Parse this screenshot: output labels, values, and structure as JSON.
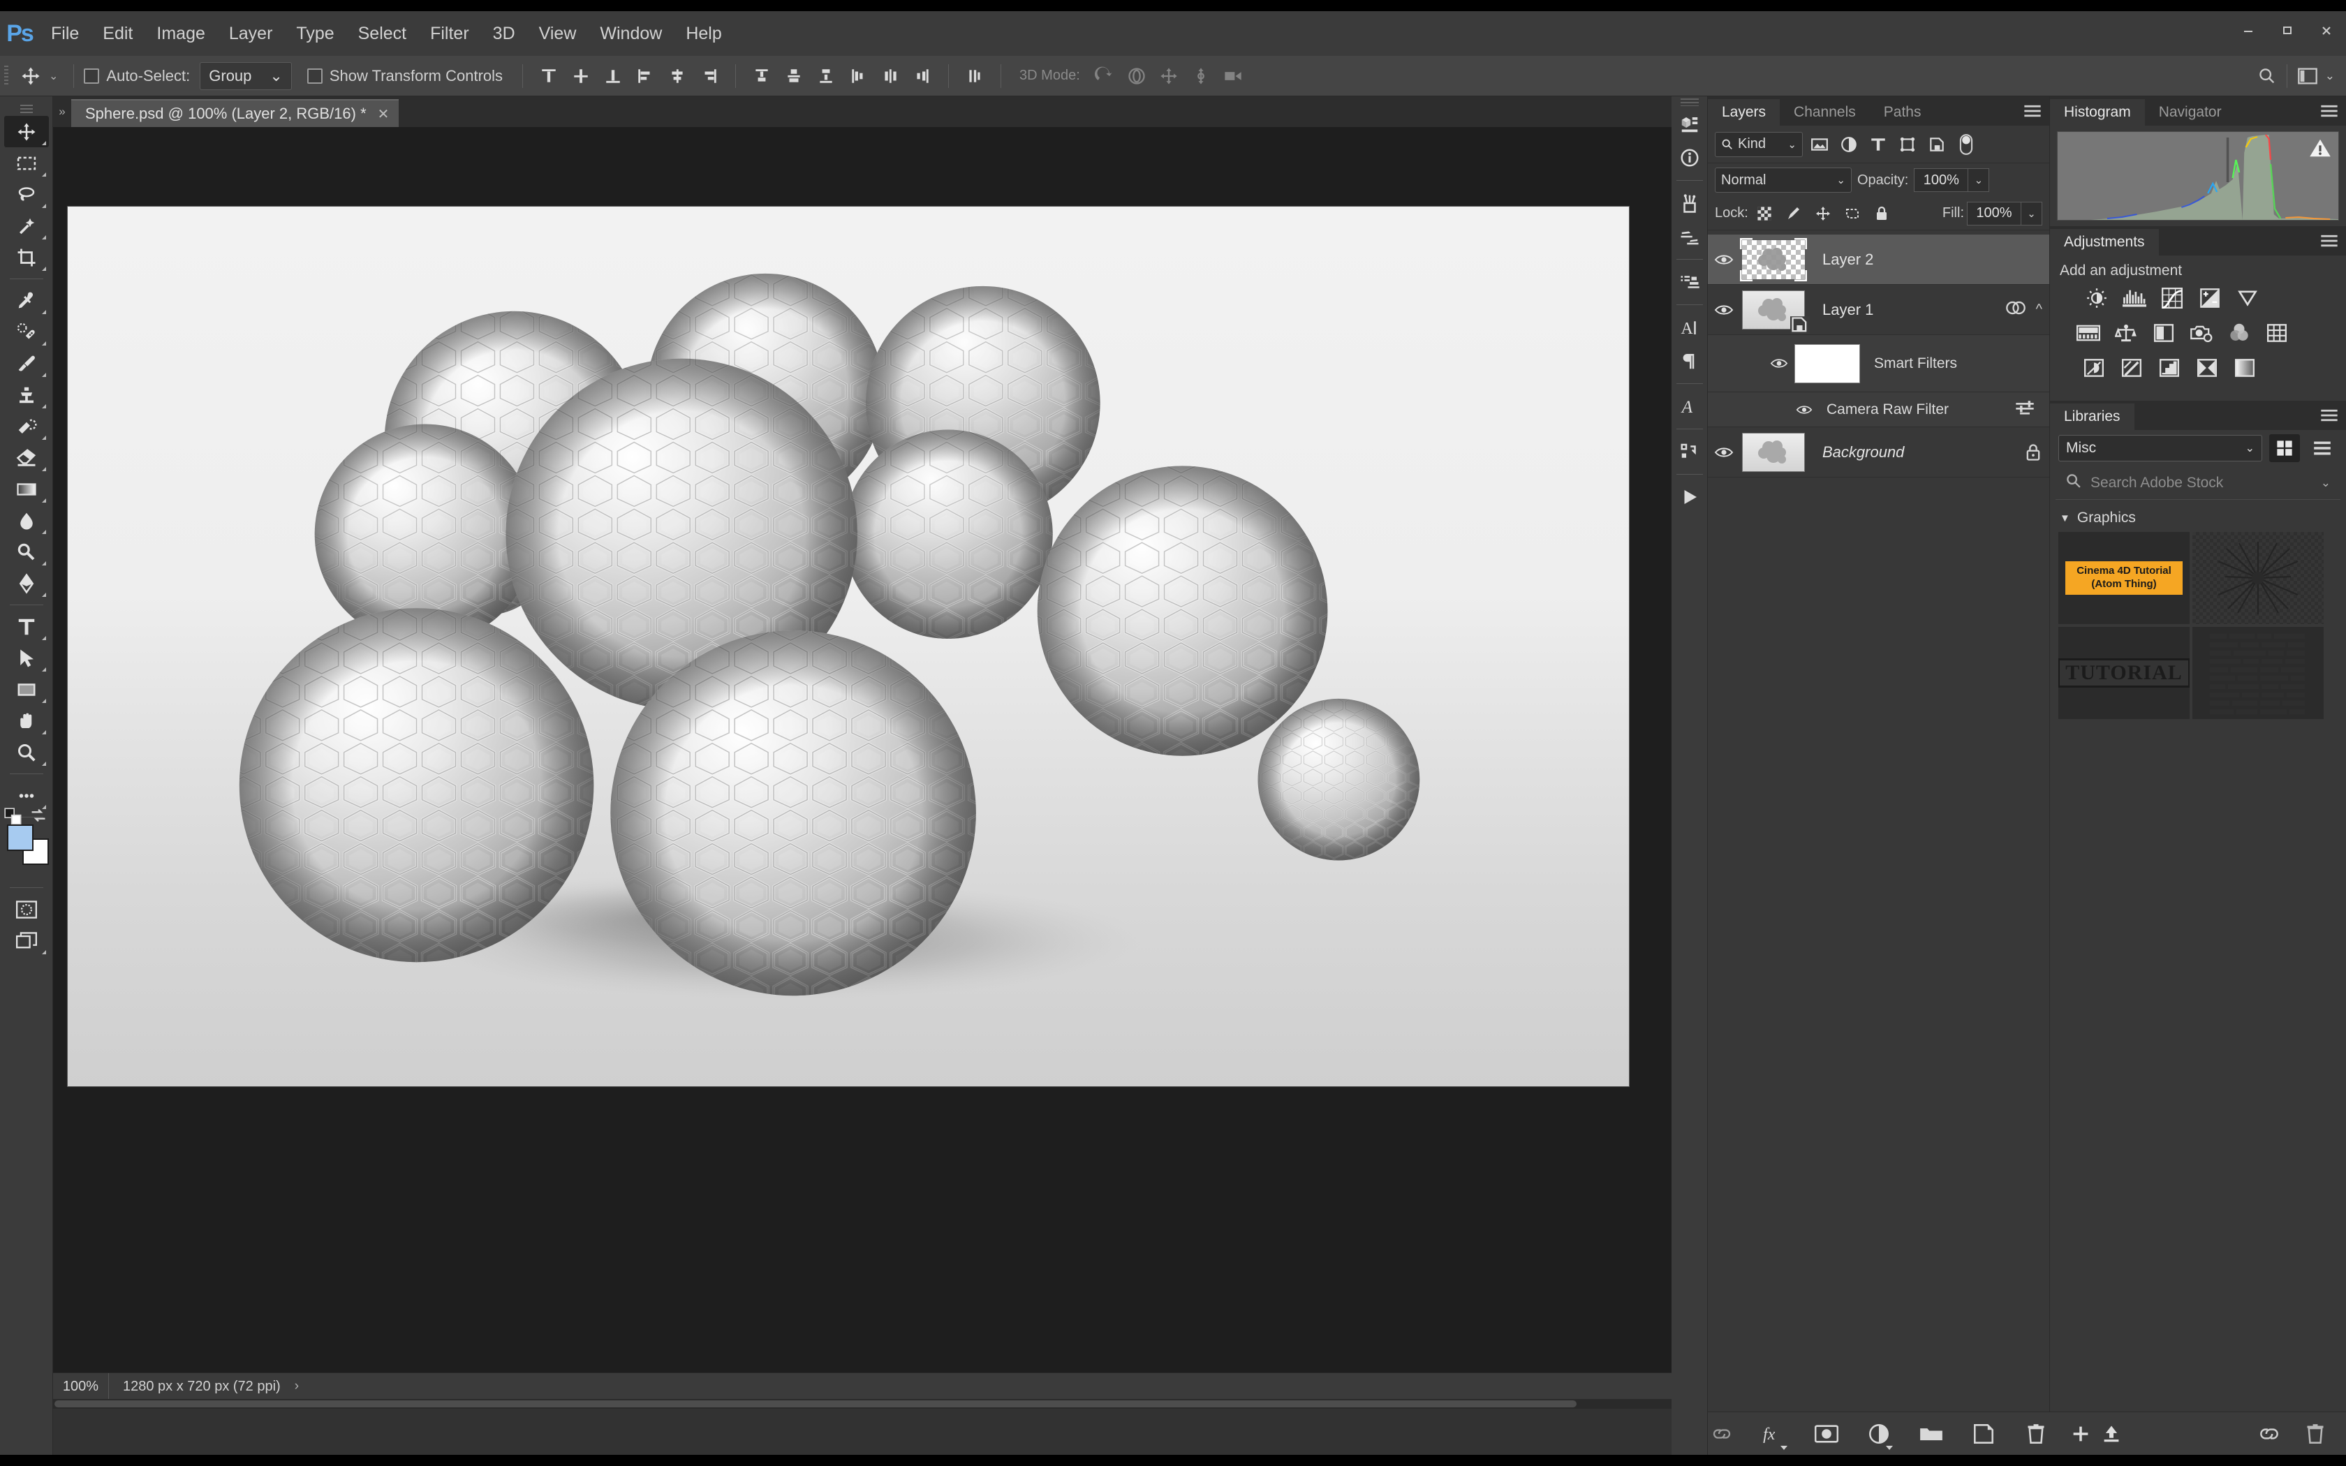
{
  "app": {
    "name": "Photoshop",
    "logo": "Ps"
  },
  "menubar": {
    "items": [
      "File",
      "Edit",
      "Image",
      "Layer",
      "Type",
      "Select",
      "Filter",
      "3D",
      "View",
      "Window",
      "Help"
    ]
  },
  "window_controls": {
    "minimize": "–",
    "maximize": "▫",
    "close": "✕"
  },
  "options_bar": {
    "tool_icon": "move-tool-icon",
    "auto_select_label": "Auto-Select:",
    "auto_select_checked": false,
    "auto_select_value": "Group",
    "show_transform_label": "Show Transform Controls",
    "show_transform_checked": false,
    "mode_3d_label": "3D Mode:",
    "align_icons": [
      "align-top-edges",
      "align-vertical-centers",
      "align-bottom-edges",
      "align-left-edges",
      "align-horizontal-centers",
      "align-right-edges"
    ],
    "distribute_icons": [
      "distribute-top-edges",
      "distribute-vertical-centers",
      "distribute-bottom-edges",
      "distribute-left-edges",
      "distribute-horizontal-centers",
      "distribute-right-edges"
    ],
    "extra_icon": "distribute-spacing-icon",
    "icons_3d": [
      "rotate-3d-object",
      "roll-3d-object",
      "drag-3d-object",
      "slide-3d-object",
      "scale-3d-object"
    ],
    "search_icon": "search-icon",
    "workspace_icon": "workspace-switcher-icon"
  },
  "toolbar": {
    "tools": [
      {
        "name": "move-tool",
        "active": true
      },
      {
        "name": "rectangular-marquee-tool",
        "active": false
      },
      {
        "name": "lasso-tool",
        "active": false
      },
      {
        "name": "quick-selection-tool",
        "active": false
      },
      {
        "name": "crop-tool",
        "active": false
      },
      {
        "name": "eyedropper-tool",
        "active": false
      },
      {
        "name": "spot-healing-brush-tool",
        "active": false
      },
      {
        "name": "brush-tool",
        "active": false
      },
      {
        "name": "clone-stamp-tool",
        "active": false
      },
      {
        "name": "history-brush-tool",
        "active": false
      },
      {
        "name": "eraser-tool",
        "active": false
      },
      {
        "name": "gradient-tool",
        "active": false
      },
      {
        "name": "blur-tool",
        "active": false
      },
      {
        "name": "dodge-tool",
        "active": false
      },
      {
        "name": "pen-tool",
        "active": false
      },
      {
        "name": "horizontal-type-tool",
        "active": false
      },
      {
        "name": "path-selection-tool",
        "active": false
      },
      {
        "name": "rectangle-tool",
        "active": false
      },
      {
        "name": "hand-tool",
        "active": false
      },
      {
        "name": "zoom-tool",
        "active": false
      },
      {
        "name": "edit-toolbar-tool",
        "active": false
      }
    ],
    "foreground_color": "#a7cbf0",
    "background_color": "#ffffff",
    "quick_mask": "edit-in-quick-mask-mode",
    "screen_mode": "change-screen-mode"
  },
  "document": {
    "tab_label": "Sphere.psd @ 100% (Layer 2, RGB/16) *",
    "close_glyph": "✕"
  },
  "status_bar": {
    "zoom": "100%",
    "doc_size": "1280 px x 720 px (72 ppi)",
    "arrow": "›"
  },
  "icon_dock": {
    "icons": [
      "properties-3d-icon",
      "info-icon",
      "brushes-icon",
      "brush-settings-icon",
      "clone-source-icon",
      "character-icon",
      "paragraph-icon",
      "glyphs-icon",
      "actions-icon",
      "play-icon"
    ]
  },
  "layers_panel": {
    "tabs": [
      {
        "label": "Layers",
        "active": true
      },
      {
        "label": "Channels",
        "active": false
      },
      {
        "label": "Paths",
        "active": false
      }
    ],
    "menu_icon": "panel-menu-icon",
    "filter": {
      "kind_label": "Kind",
      "icons": [
        "filter-pixel-icon",
        "filter-adjustment-icon",
        "filter-type-icon",
        "filter-shape-icon",
        "filter-smartobject-icon"
      ],
      "toggle": "filter-toggle-switch"
    },
    "blend_mode": "Normal",
    "opacity_label": "Opacity:",
    "opacity_value": "100%",
    "lock_label": "Lock:",
    "lock_icons": [
      "lock-transparent-pixels",
      "lock-image-pixels",
      "lock-position",
      "lock-artboard-nesting",
      "lock-all"
    ],
    "fill_label": "Fill:",
    "fill_value": "100%",
    "layers": [
      {
        "name": "Layer 2",
        "visible": true,
        "selected": true,
        "thumb": "transparent",
        "italic": false
      },
      {
        "name": "Layer 1",
        "visible": true,
        "selected": false,
        "thumb": "image",
        "italic": false,
        "smart_object": true,
        "filter_badge": "smart-filter-icon",
        "collapse": "^"
      },
      {
        "name": "Background",
        "visible": true,
        "selected": false,
        "thumb": "image",
        "italic": true,
        "locked": true
      }
    ],
    "smart_filters": {
      "label": "Smart Filters",
      "visible": true,
      "filters": [
        {
          "label": "Camera Raw Filter",
          "visible": true
        }
      ]
    },
    "bottom_buttons": [
      "link-layers-icon",
      "layer-style-fx-icon",
      "add-layer-mask-icon",
      "new-adjustment-layer-icon",
      "new-group-icon",
      "new-layer-icon",
      "delete-layer-icon"
    ]
  },
  "histogram_panel": {
    "tabs": [
      {
        "label": "Histogram",
        "active": true
      },
      {
        "label": "Navigator",
        "active": false
      }
    ],
    "menu_icon": "panel-menu-icon",
    "warning_icon": "uncached-data-warning-icon"
  },
  "adjustments_panel": {
    "title": "Adjustments",
    "menu_icon": "panel-menu-icon",
    "subtitle": "Add an adjustment",
    "icons": [
      "brightness-contrast-icon",
      "levels-icon",
      "curves-icon",
      "exposure-icon",
      "vibrance-icon",
      "hue-saturation-icon",
      "color-balance-icon",
      "black-and-white-icon",
      "photo-filter-icon",
      "channel-mixer-icon",
      "color-lookup-icon",
      "invert-icon",
      "posterize-icon",
      "threshold-icon",
      "selective-color-icon",
      "gradient-map-icon"
    ]
  },
  "libraries_panel": {
    "title": "Libraries",
    "menu_icon": "panel-menu-icon",
    "selected_library": "Misc",
    "view_grid_icon": "grid-view-icon",
    "view_list_icon": "list-view-icon",
    "search_placeholder": "Search Adobe Stock",
    "search_icon": "search-icon",
    "group_label": "Graphics",
    "items": [
      {
        "type": "text-badge",
        "label": "Cinema 4D Tutorial\n(Atom Thing)",
        "color": "#f5a623"
      },
      {
        "type": "transparent-art",
        "label": ""
      },
      {
        "type": "tutorial-wordmark",
        "label": "TUTORIAL"
      },
      {
        "type": "text-block",
        "label": ""
      }
    ],
    "bottom_buttons": [
      "add-content-icon",
      "upload-icon",
      "creative-cloud-sync-icon",
      "delete-icon"
    ]
  },
  "canvas": {
    "artwork_description": "chrome hexagon-patterned sphere cluster",
    "cursor": "move-tool-cursor"
  }
}
